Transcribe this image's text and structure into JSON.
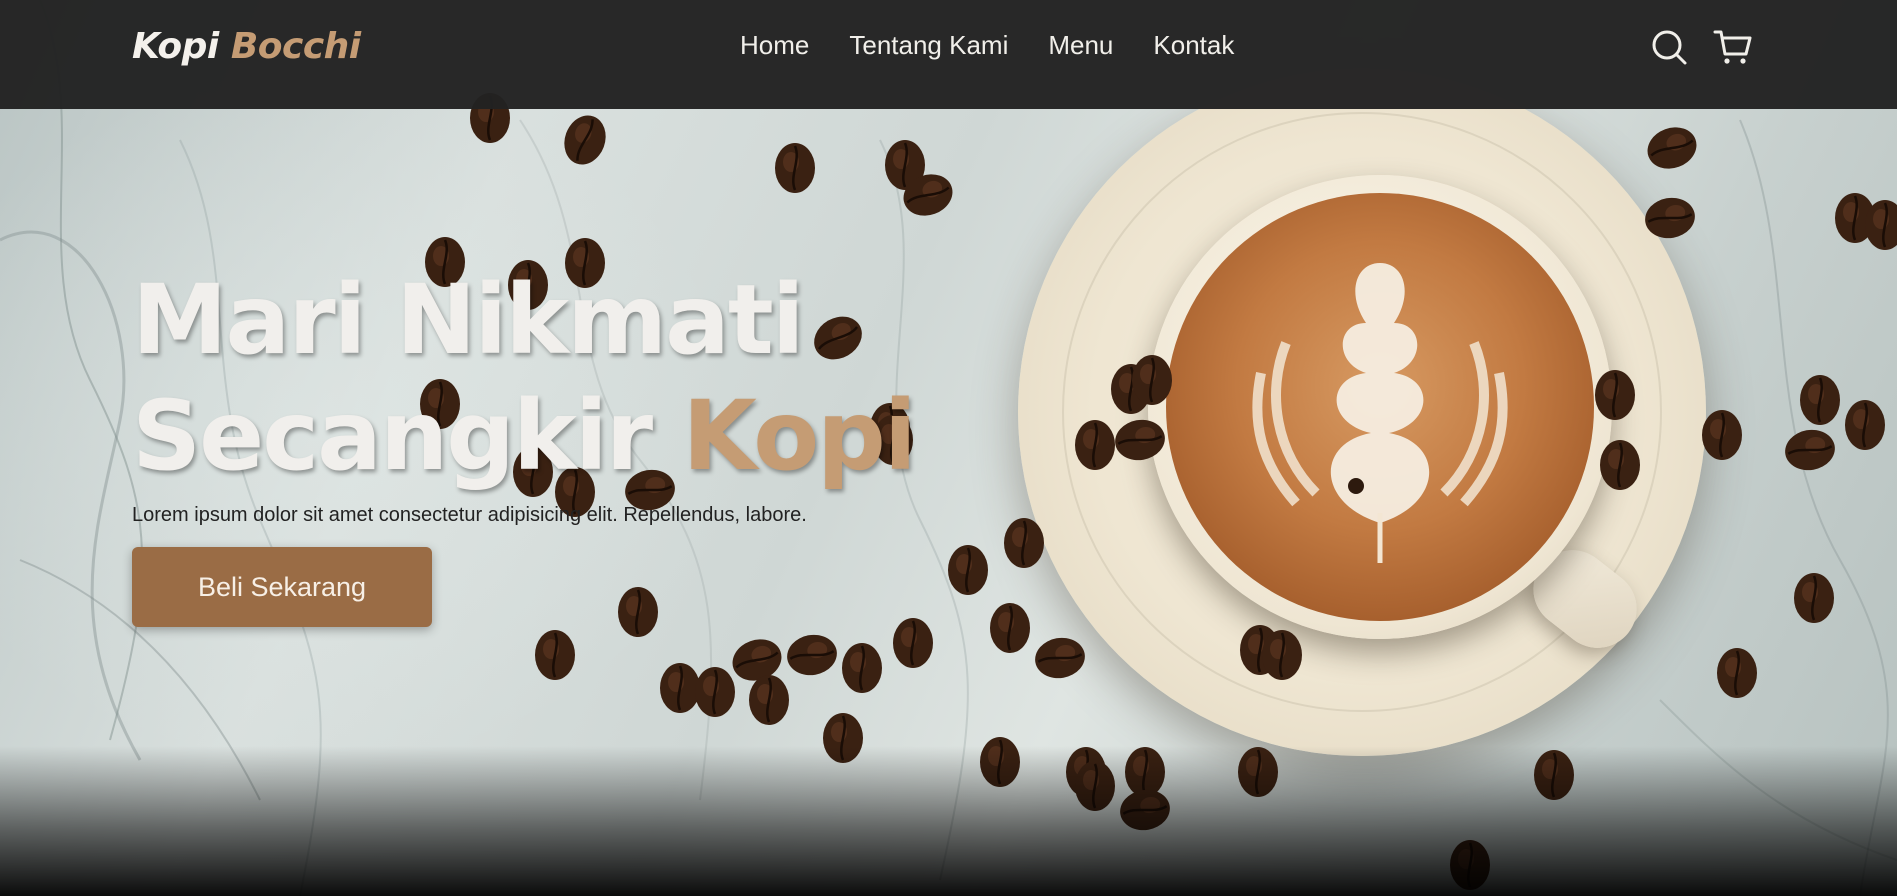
{
  "brand": {
    "logo_primary": "Kopi",
    "logo_accent": "Bocchi",
    "accent_color": "#c59c74",
    "button_color": "#9a6c45",
    "navbar_color": "#222222"
  },
  "nav": {
    "links": [
      {
        "label": "Home"
      },
      {
        "label": "Tentang Kami"
      },
      {
        "label": "Menu"
      },
      {
        "label": "Kontak"
      }
    ],
    "icons": [
      "search-icon",
      "shopping-cart-icon"
    ]
  },
  "hero": {
    "title_line1": "Mari Nikmati",
    "title_line2_prefix": "Secangkir ",
    "title_line2_accent": "Kopi",
    "description": "Lorem ipsum dolor sit amet consectetur adipisicing elit. Repellendus, labore.",
    "cta_label": "Beli Sekarang"
  }
}
